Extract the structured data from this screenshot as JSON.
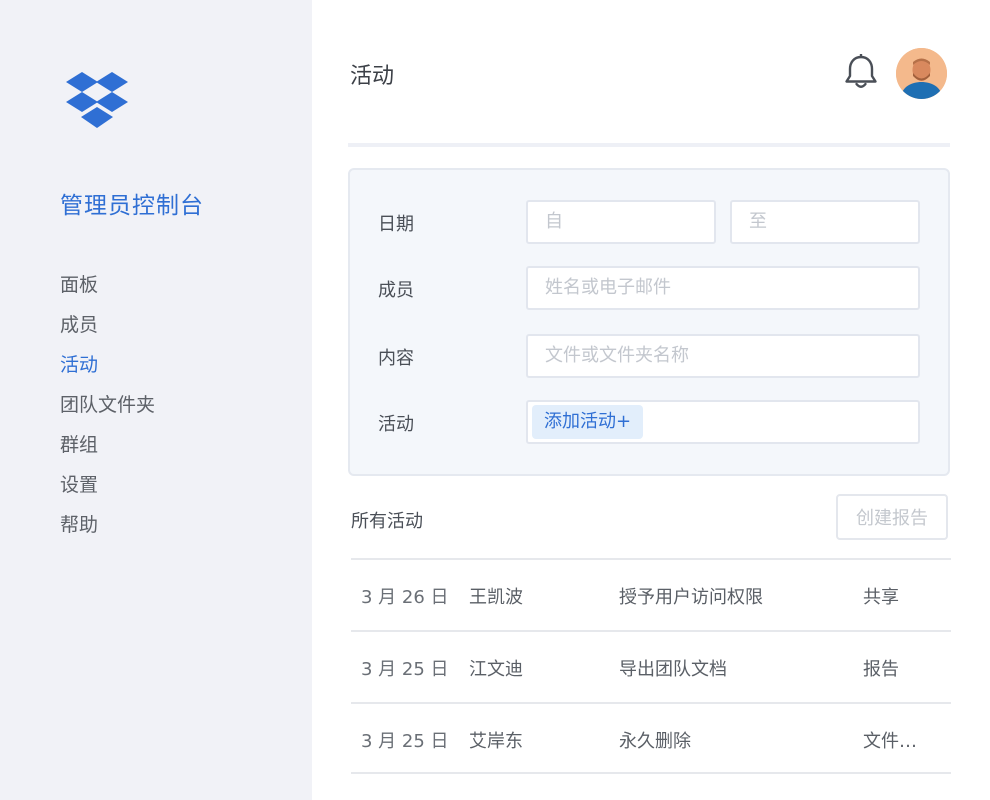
{
  "sidebar": {
    "logo_icon": "dropbox-logo",
    "title": "管理员控制台",
    "items": [
      {
        "label": "面板",
        "active": false
      },
      {
        "label": "成员",
        "active": false
      },
      {
        "label": "活动",
        "active": true
      },
      {
        "label": "团队文件夹",
        "active": false
      },
      {
        "label": "群组",
        "active": false
      },
      {
        "label": "设置",
        "active": false
      },
      {
        "label": "帮助",
        "active": false
      }
    ]
  },
  "header": {
    "title": "活动",
    "bell_icon": "bell-icon",
    "avatar_icon": "user-avatar"
  },
  "filter": {
    "date_label": "日期",
    "date_from_placeholder": "自",
    "date_to_placeholder": "至",
    "member_label": "成员",
    "member_placeholder": "姓名或电子邮件",
    "content_label": "内容",
    "content_placeholder": "文件或文件夹名称",
    "activity_label": "活动",
    "add_activity": "添加活动+"
  },
  "list": {
    "title": "所有活动",
    "report_button": "创建报告",
    "rows": [
      {
        "date": "3 月 26 日",
        "user": "王凯波",
        "action": "授予用户访问权限",
        "category": "共享"
      },
      {
        "date": "3 月 25 日",
        "user": "江文迪",
        "action": "导出团队文档",
        "category": "报告"
      },
      {
        "date": "3 月 25 日",
        "user": "艾岸东",
        "action": "永久删除",
        "category": "文件…"
      }
    ]
  },
  "colors": {
    "accent": "#2f6fd4",
    "sidebar_bg": "#f1f2f7",
    "panel_bg": "#f4f7fb"
  }
}
